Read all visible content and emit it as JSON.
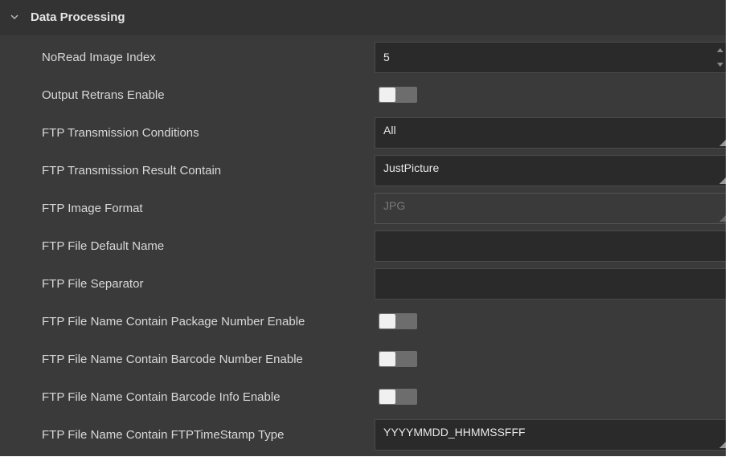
{
  "section": {
    "title": "Data Processing",
    "expanded_icon": "chevron-down-icon"
  },
  "rows": [
    {
      "label": "NoRead Image Index",
      "control": "spinbox",
      "value": "5"
    },
    {
      "label": "Output Retrans Enable",
      "control": "toggle",
      "value": "off"
    },
    {
      "label": "FTP Transmission Conditions",
      "control": "combobox",
      "value": "All"
    },
    {
      "label": "FTP Transmission Result Contain",
      "control": "combobox",
      "value": "JustPicture"
    },
    {
      "label": "FTP Image Format",
      "control": "combobox",
      "value": "JPG",
      "disabled": true
    },
    {
      "label": "FTP File Default Name",
      "control": "text",
      "value": ""
    },
    {
      "label": "FTP File Separator",
      "control": "text",
      "value": ""
    },
    {
      "label": "FTP File Name Contain Package Number Enable",
      "control": "toggle",
      "value": "off"
    },
    {
      "label": "FTP File Name Contain Barcode Number Enable",
      "control": "toggle",
      "value": "off"
    },
    {
      "label": "FTP File Name Contain Barcode Info Enable",
      "control": "toggle",
      "value": "off"
    },
    {
      "label": "FTP File Name Contain FTPTimeStamp Type",
      "control": "combobox",
      "value": "YYYYMMDD_HHMMSSFFF"
    }
  ],
  "colors": {
    "panel_bg": "#3a3a3a",
    "header_bg": "#333333",
    "field_bg": "#2a2a2a",
    "text": "#d8d8d8",
    "toggle_track": "#6d6d6d",
    "toggle_knob": "#f0f0f0"
  }
}
